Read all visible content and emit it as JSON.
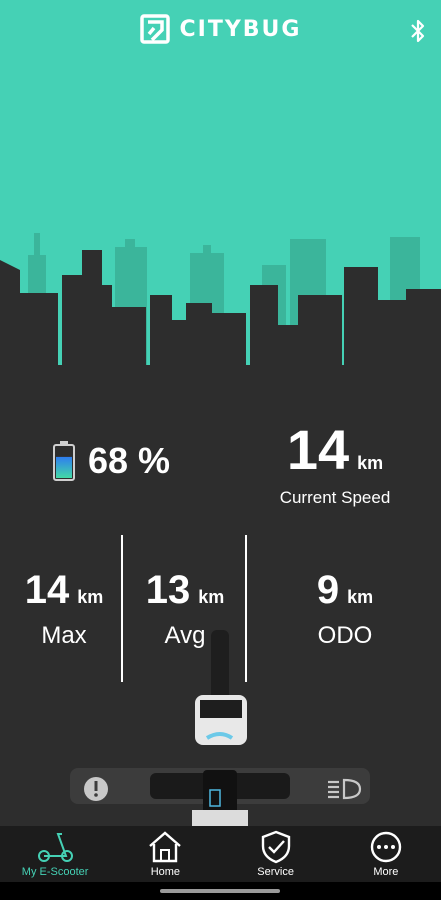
{
  "brand": {
    "name": "CITYBUG"
  },
  "icons": {
    "logo": "citybug-logo-icon",
    "bluetooth": "bluetooth-icon",
    "battery": "battery-icon",
    "warning": "warning-icon",
    "headlight": "headlight-icon"
  },
  "colors": {
    "accent": "#45d1b5",
    "background": "#2d2d2d",
    "nav_background": "#1c1c1c"
  },
  "battery": {
    "value": "68 %",
    "level": 0.68
  },
  "current_speed": {
    "value": "14",
    "unit": "km",
    "label": "Current Speed"
  },
  "stats": [
    {
      "value": "14",
      "unit": "km",
      "label": "Max"
    },
    {
      "value": "13",
      "unit": "km",
      "label": "Avg"
    },
    {
      "value": "9",
      "unit": "km",
      "label": "ODO"
    }
  ],
  "nav": [
    {
      "label": "My E-Scooter",
      "icon": "scooter-icon",
      "active": true
    },
    {
      "label": "Home",
      "icon": "home-icon",
      "active": false
    },
    {
      "label": "Service",
      "icon": "shield-check-icon",
      "active": false
    },
    {
      "label": "More",
      "icon": "more-icon",
      "active": false
    }
  ]
}
